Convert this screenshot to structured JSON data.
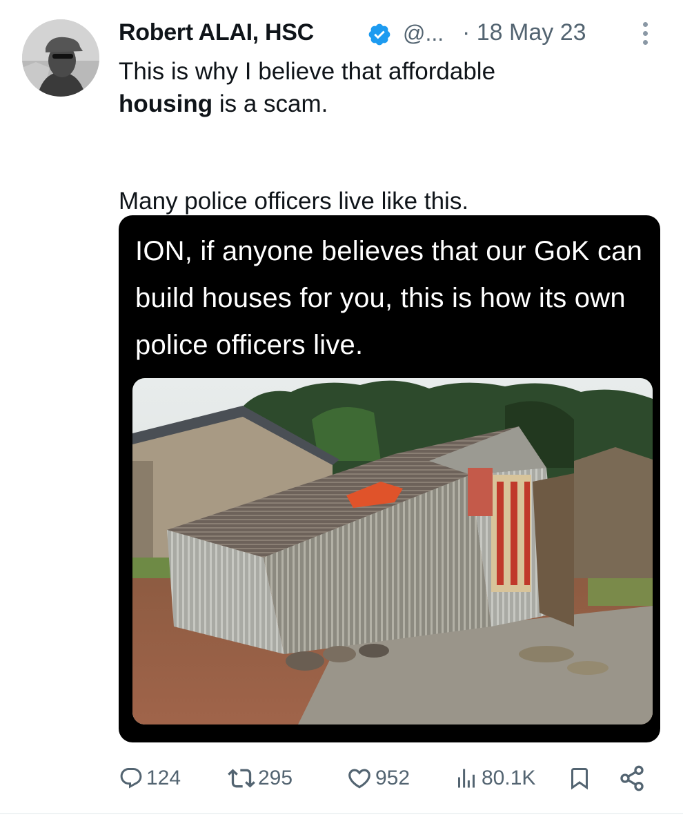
{
  "tweet": {
    "author_name": "Robert ALAI, HSC",
    "handle": "@...",
    "date": "· 18 May 23",
    "text_line1": "This is why I believe that affordable",
    "text_bold": "housing",
    "text_line2_rest": " is a scam.",
    "text_line3": "Many police officers live like this."
  },
  "media": {
    "caption": "ION, if anyone believes that our GoK can build houses for you, this is how its own police officers live."
  },
  "actions": {
    "replies": "124",
    "retweets": "295",
    "likes": "952",
    "views": "80.1K"
  },
  "icons": {
    "verified": "verified-badge-icon",
    "more": "more-vertical-icon",
    "reply": "reply-icon",
    "retweet": "retweet-icon",
    "like": "heart-icon",
    "views": "views-icon",
    "bookmark": "bookmark-icon",
    "share": "share-icon"
  },
  "colors": {
    "verified_blue": "#1d9bf0",
    "secondary_text": "#536471",
    "media_background": "#000000"
  }
}
